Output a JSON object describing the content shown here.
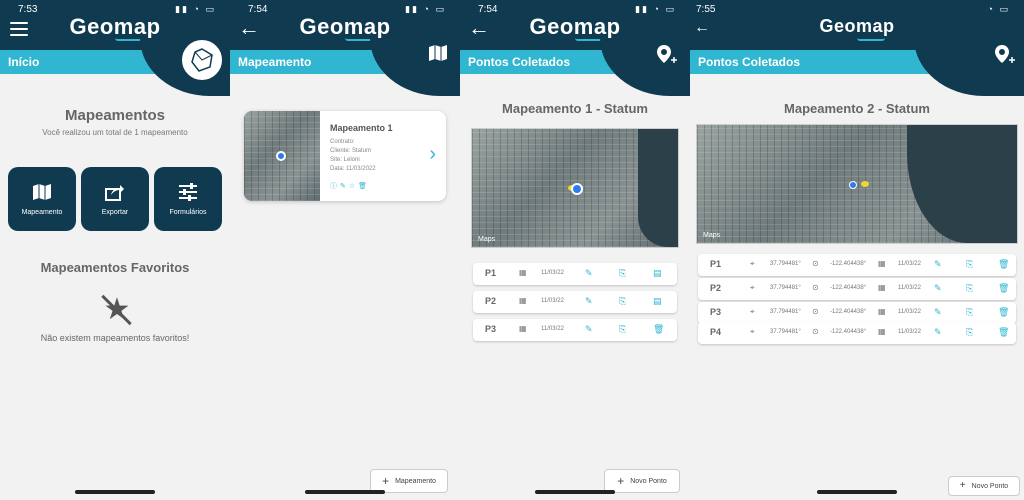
{
  "brand": "Geomap",
  "colors": {
    "header": "#0f3a4f",
    "accent": "#30b6d0",
    "background": "#f2f2f2"
  },
  "screen1": {
    "time": "7:53",
    "section_title": "Início",
    "title": "Mapeamentos",
    "subtitle": "Você realizou um total de 1 mapeamento",
    "tiles": [
      {
        "label": "Mapeamento",
        "icon": "map-icon"
      },
      {
        "label": "Exportar",
        "icon": "share-icon"
      },
      {
        "label": "Formulários",
        "icon": "sliders-icon"
      }
    ],
    "favorites_title": "Mapeamentos Favoritos",
    "favorites_empty": "Não existem mapeamentos favoritos!"
  },
  "screen2": {
    "time": "7:54",
    "section_title": "Mapeamento",
    "card": {
      "title": "Mapeamento 1",
      "lines": [
        "Contrato:",
        "Cliente: Statum",
        "Site: Leloni",
        "Data: 11/03/2022"
      ]
    },
    "add_button": "Mapeamento"
  },
  "screen3": {
    "time": "7:54",
    "section_title": "Pontos Coletados",
    "map_title": "Mapeamento 1 - Statum",
    "map_badge": "Maps",
    "points": [
      {
        "label": "P1",
        "date": "11/03/22"
      },
      {
        "label": "P2",
        "date": "11/03/22"
      },
      {
        "label": "P3",
        "date": "11/03/22"
      }
    ],
    "add_button": "Novo Ponto"
  },
  "screen4": {
    "time": "7:55",
    "section_title": "Pontos Coletados",
    "map_title": "Mapeamento 2 - Statum",
    "map_badge": "Maps",
    "points": [
      {
        "label": "P1",
        "lat": "37.794481°",
        "lon": "-122.404438°",
        "date": "11/03/22"
      },
      {
        "label": "P2",
        "lat": "37.794481°",
        "lon": "-122.404438°",
        "date": "11/03/22"
      },
      {
        "label": "P3",
        "lat": "37.794481°",
        "lon": "-122.404438°",
        "date": "11/03/22"
      },
      {
        "label": "P4",
        "lat": "37.794481°",
        "lon": "-122.404438°",
        "date": "11/03/22"
      }
    ],
    "add_button": "Novo Ponto"
  }
}
